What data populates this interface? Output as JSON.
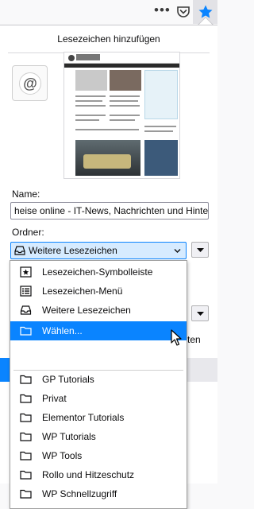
{
  "toolbar": {
    "overflow_icon": "ellipsis-icon",
    "pocket_icon": "pocket-icon",
    "bookmark_star_icon": "star-icon",
    "accent": "#0a84ff"
  },
  "panel": {
    "title": "Lesezeichen hinzufügen",
    "name_label": "Name:",
    "name_value": "heise online - IT-News, Nachrichten und Hintergründe",
    "folder_label": "Ordner:",
    "folder_selected": "Weitere Lesezeichen",
    "folder_selected_icon": "tray-icon",
    "behind_partial_text": "ten"
  },
  "folder_menu": {
    "items": [
      {
        "label": "Lesezeichen-Symbolleiste",
        "icon": "toolbar-icon"
      },
      {
        "label": "Lesezeichen-Menü",
        "icon": "menu-icon"
      },
      {
        "label": "Weitere Lesezeichen",
        "icon": "tray-icon"
      },
      {
        "label": "Wählen...",
        "icon": "folder-icon",
        "highlighted": true
      },
      {
        "label": "GP Tutorials",
        "icon": "folder-icon"
      },
      {
        "label": "Privat",
        "icon": "folder-icon"
      },
      {
        "label": "Elementor Tutorials",
        "icon": "folder-icon"
      },
      {
        "label": "WP Tutorials",
        "icon": "folder-icon"
      },
      {
        "label": "WP Tools",
        "icon": "folder-icon"
      },
      {
        "label": "Rollo und Hitzeschutz",
        "icon": "folder-icon"
      },
      {
        "label": "WP Schnellzugriff",
        "icon": "folder-icon"
      }
    ]
  }
}
